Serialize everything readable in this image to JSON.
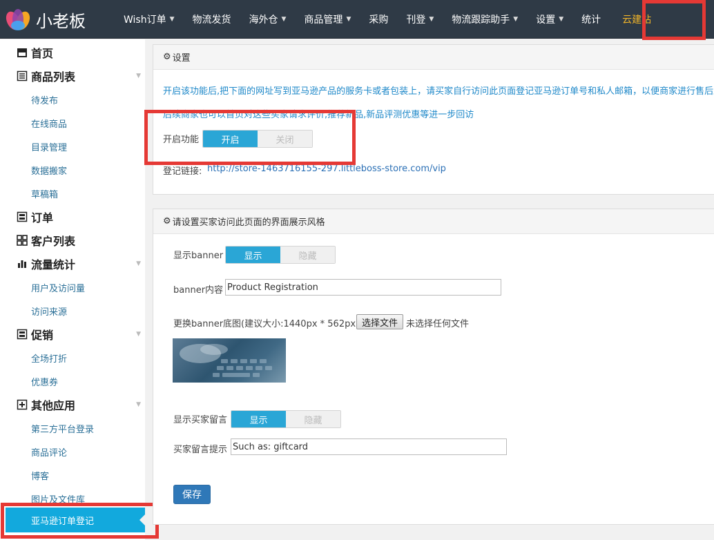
{
  "brand": {
    "name": "小老板"
  },
  "nav": [
    {
      "label": "Wish订单",
      "caret": true
    },
    {
      "label": "物流发货",
      "caret": false
    },
    {
      "label": "海外仓",
      "caret": true
    },
    {
      "label": "商品管理",
      "caret": true
    },
    {
      "label": "采购",
      "caret": false
    },
    {
      "label": "刊登",
      "caret": true
    },
    {
      "label": "物流跟踪助手",
      "caret": true
    },
    {
      "label": "设置",
      "caret": true
    },
    {
      "label": "统计",
      "caret": false
    },
    {
      "label": "云建站",
      "caret": false
    }
  ],
  "sidebar": {
    "home": "首页",
    "products": "商品列表",
    "products_items": [
      "待发布",
      "在线商品",
      "目录管理",
      "数据搬家",
      "草稿箱"
    ],
    "orders": "订单",
    "customers": "客户列表",
    "traffic": "流量统计",
    "traffic_items": [
      "用户及访问量",
      "访问来源"
    ],
    "promo": "促销",
    "promo_items": [
      "全场打折",
      "优惠券"
    ],
    "other": "其他应用",
    "other_items": [
      "第三方平台登录",
      "商品评论",
      "博客",
      "图片及文件库"
    ],
    "active": "亚马逊订单登记"
  },
  "settings": {
    "title": "设置",
    "desc1": "开启该功能后,把下面的网址写到亚马逊产品的服务卡或者包装上，请买家自行访问此页面登记亚马逊订单号和私人邮箱，以便商家进行售后跟",
    "desc2": "后续商家也可以首页对这些买家请求评价,推荐新品,新品评测优惠等进一步回访",
    "enable_label": "开启功能",
    "on": "开启",
    "off": "关闭",
    "link_label": "登记链接:",
    "link_url": "http://store-1463716155-297.littleboss-store.com/vip"
  },
  "style": {
    "title": "请设置买家访问此页面的界面展示风格",
    "banner_label": "显示banner",
    "show": "显示",
    "hide": "隐藏",
    "banner_content_label": "banner内容",
    "banner_content_value": "Product Registration",
    "banner_bg_label": "更换banner底图(建议大小:1440px * 562px)",
    "file_button": "选择文件",
    "file_none": "未选择任何文件",
    "buyer_msg_label": "显示买家留言",
    "buyer_hint_label": "买家留言提示",
    "buyer_hint_value": "Such as: giftcard",
    "save": "保存"
  },
  "colors": {
    "accent": "#12a9dd",
    "toggle_on": "#2aa6d6",
    "nav_bg": "#2f3a46",
    "highlight": "#e53935"
  }
}
